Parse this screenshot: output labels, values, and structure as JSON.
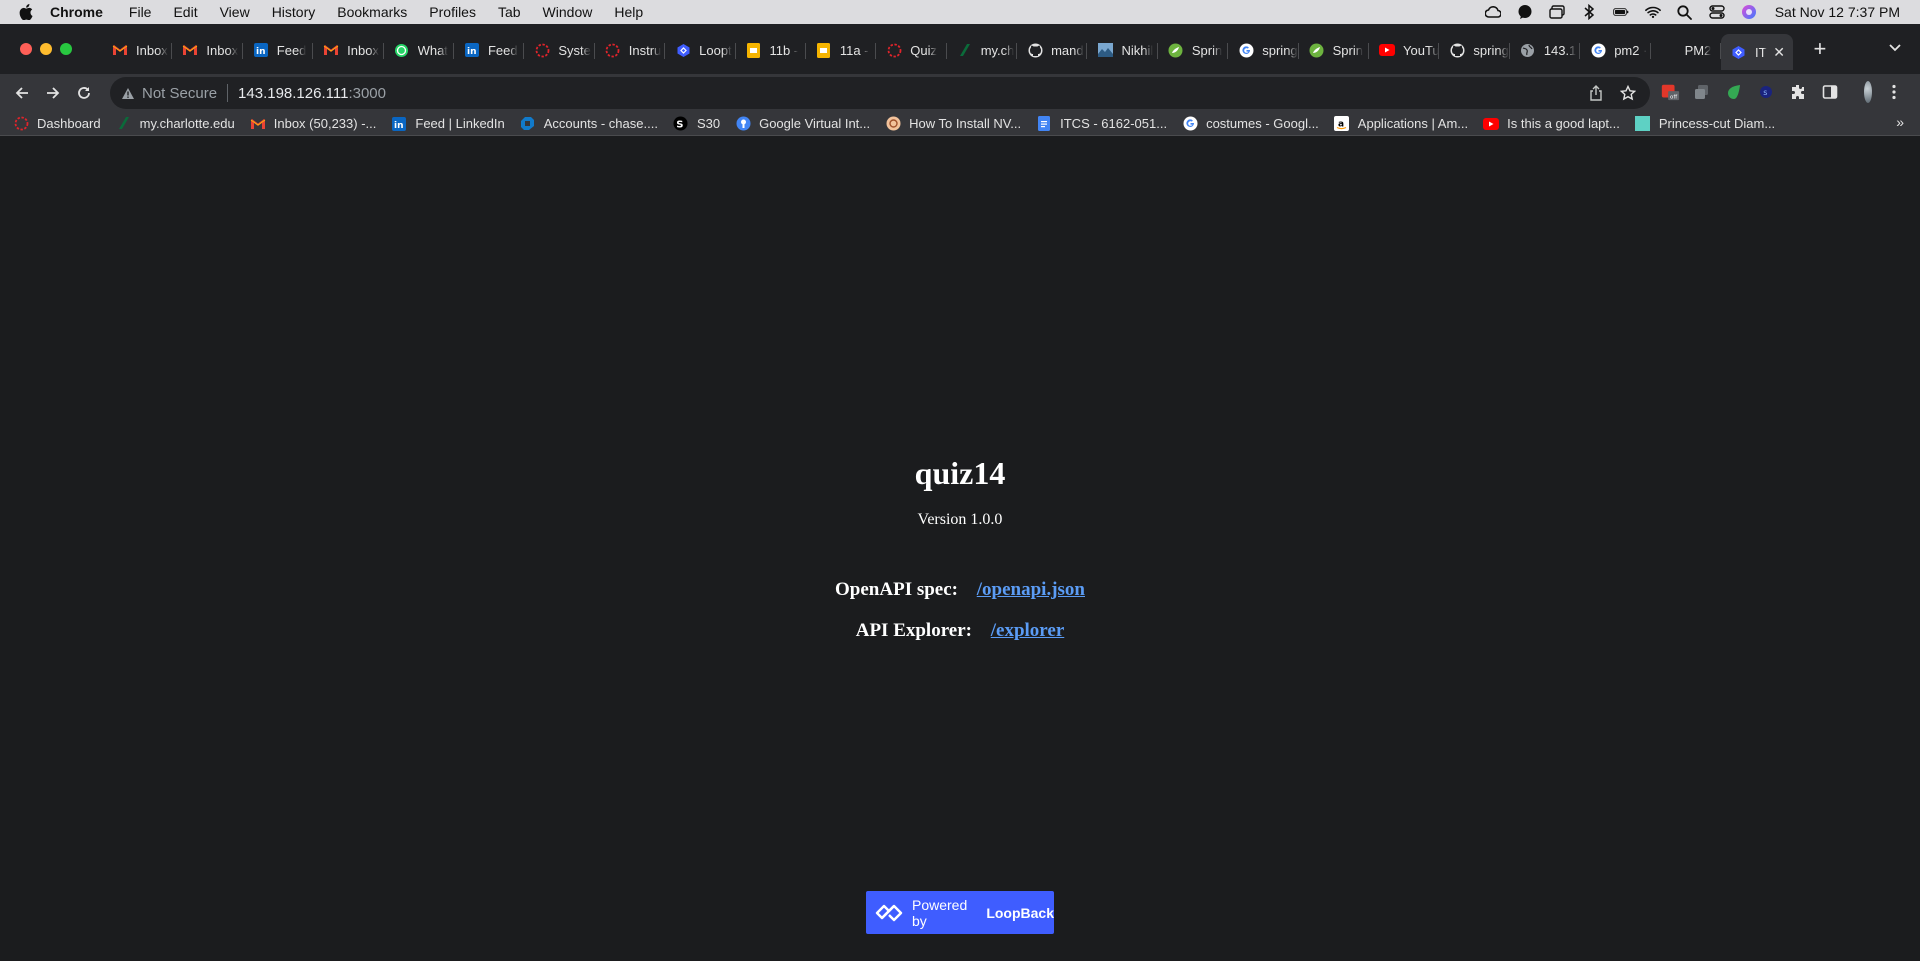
{
  "menubar": {
    "app": "Chrome",
    "items": [
      "File",
      "Edit",
      "View",
      "History",
      "Bookmarks",
      "Profiles",
      "Tab",
      "Window",
      "Help"
    ],
    "clock": "Sat Nov 12  7:37 PM"
  },
  "tabs": [
    {
      "label": "Inbox",
      "icon": "gmail-icon"
    },
    {
      "label": "Inbox",
      "icon": "gmail-icon"
    },
    {
      "label": "Feed",
      "icon": "linkedin-icon"
    },
    {
      "label": "Inbox",
      "icon": "gmail-icon"
    },
    {
      "label": "What",
      "icon": "whatsapp-icon"
    },
    {
      "label": "Feed",
      "icon": "linkedin-icon"
    },
    {
      "label": "Syste",
      "icon": "dashed-circle-icon"
    },
    {
      "label": "Instru",
      "icon": "dashed-circle-icon"
    },
    {
      "label": "Loopt",
      "icon": "loopback-icon"
    },
    {
      "label": "11b -",
      "icon": "slides-icon"
    },
    {
      "label": "11a -",
      "icon": "slides-icon"
    },
    {
      "label": "Quiz",
      "icon": "dashed-circle-icon"
    },
    {
      "label": "my.ch",
      "icon": "charlotte-icon"
    },
    {
      "label": "mand",
      "icon": "github-icon"
    },
    {
      "label": "Nikhil",
      "icon": "image-icon"
    },
    {
      "label": "Sprin",
      "icon": "spring-icon"
    },
    {
      "label": "spring",
      "icon": "google-icon"
    },
    {
      "label": "Sprin",
      "icon": "spring-icon"
    },
    {
      "label": "YouTu",
      "icon": "youtube-icon"
    },
    {
      "label": "spring",
      "icon": "github-icon"
    },
    {
      "label": "143.1",
      "icon": "globe-icon"
    },
    {
      "label": "pm2 ·",
      "icon": "google-icon"
    },
    {
      "label": "PM2",
      "icon": "pm2-icon"
    },
    {
      "label": "IT",
      "icon": "loopback-icon",
      "active": true
    }
  ],
  "address": {
    "security": "Not Secure",
    "host": "143.198.126.111",
    "port": ":3000"
  },
  "bookmarks": [
    {
      "label": "Dashboard",
      "icon": "dashed-circle-icon"
    },
    {
      "label": "my.charlotte.edu",
      "icon": "charlotte-icon"
    },
    {
      "label": "Inbox (50,233) -...",
      "icon": "gmail-icon"
    },
    {
      "label": "Feed | LinkedIn",
      "icon": "linkedin-icon"
    },
    {
      "label": "Accounts - chase....",
      "icon": "chase-icon"
    },
    {
      "label": "S30",
      "icon": "s30-icon"
    },
    {
      "label": "Google Virtual Int...",
      "icon": "google-info-icon"
    },
    {
      "label": "How To Install NV...",
      "icon": "nvidia-icon"
    },
    {
      "label": "ITCS - 6162-051...",
      "icon": "docs-icon"
    },
    {
      "label": "costumes - Googl...",
      "icon": "google-icon"
    },
    {
      "label": "Applications | Am...",
      "icon": "amazon-icon"
    },
    {
      "label": "Is this a good lapt...",
      "icon": "youtube-icon"
    },
    {
      "label": "Princess-cut Diam...",
      "icon": "teal-square-icon"
    }
  ],
  "page": {
    "title": "quiz14",
    "version": "Version 1.0.0",
    "openapi_label": "OpenAPI spec:",
    "openapi_link": "/openapi.json",
    "explorer_label": "API Explorer:",
    "explorer_link": "/explorer",
    "powered_prefix": "Powered by",
    "powered_brand": "LoopBack"
  },
  "colors": {
    "page_bg": "#1b1c1e",
    "link": "#5b9cf5",
    "loopback_blue": "#3f5dff",
    "toolbar": "#35363a",
    "tabstrip": "#1f2023"
  }
}
